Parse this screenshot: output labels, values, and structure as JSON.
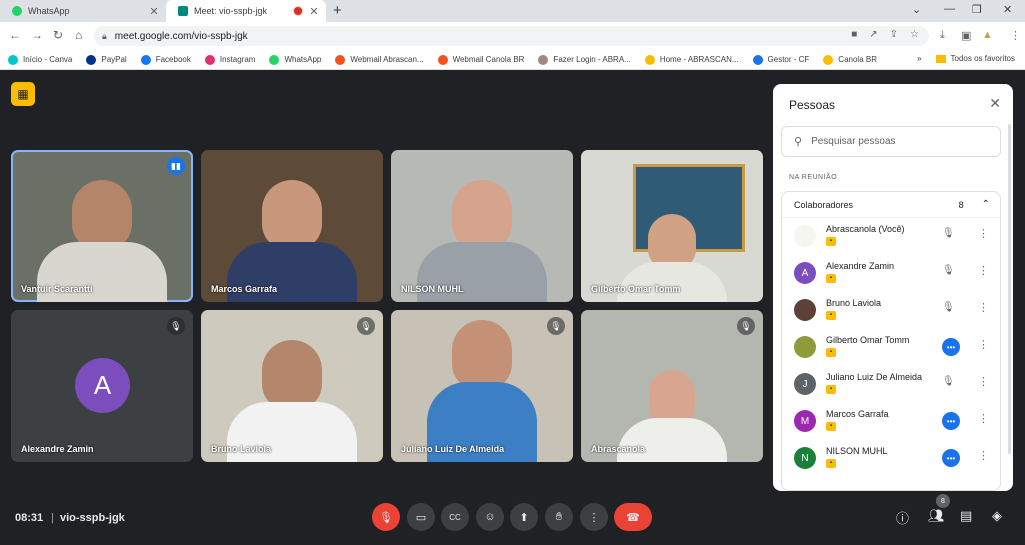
{
  "browser": {
    "tabs": [
      {
        "label": "WhatsApp",
        "active": false,
        "favicon_color": "#25d366"
      },
      {
        "label": "Meet: vio-sspb-jgk",
        "active": true,
        "favicon_color": "#00897b"
      }
    ],
    "new_tab_icon": "plus-icon",
    "url": "meet.google.com/vio-sspb-jgk",
    "bookmarks": [
      {
        "label": "Início - Canva",
        "color": "#00c4cc"
      },
      {
        "label": "PayPal",
        "color": "#003087"
      },
      {
        "label": "Facebook",
        "color": "#1877f2"
      },
      {
        "label": "Instagram",
        "color": "#e1306c"
      },
      {
        "label": "WhatsApp",
        "color": "#25d366"
      },
      {
        "label": "Webmail Abrascan...",
        "color": "#f4511e"
      },
      {
        "label": "Webmail Canola BR",
        "color": "#f4511e"
      },
      {
        "label": "Fazer Login - ABRA...",
        "color": "#a1887f"
      },
      {
        "label": "Home - ABRASCAN...",
        "color": "#fbbc04"
      },
      {
        "label": "Gestor - CF",
        "color": "#1a73e8"
      },
      {
        "label": "Canola BR",
        "color": "#fbbc04"
      }
    ],
    "bookmarks_more": "»",
    "favorites_label": "Todos os favoritos"
  },
  "meet": {
    "tiles": [
      {
        "name": "Vantuir Scarantti",
        "status": "speaking"
      },
      {
        "name": "Marcos Garrafa",
        "status": ""
      },
      {
        "name": "NILSON MUHL",
        "status": ""
      },
      {
        "name": "Gilberto Omar Tomm",
        "status": ""
      },
      {
        "name": "Alexandre Zamin",
        "status": "muted",
        "initial": "A"
      },
      {
        "name": "Bruno Laviola",
        "status": "muted"
      },
      {
        "name": "Juliano Luiz De Almeida",
        "status": "muted"
      },
      {
        "name": "Abrascanola",
        "status": "muted"
      }
    ],
    "time": "08:31",
    "separator": "|",
    "meeting_code": "vio-sspb-jgk",
    "participant_count": "8"
  },
  "panel": {
    "title": "Pessoas",
    "search_placeholder": "Pesquisar pessoas",
    "section_label": "NA REUNIÃO",
    "group_label": "Colaboradores",
    "group_count": "8",
    "people": [
      {
        "name": "Abrascanola (Você)",
        "initial": "",
        "color": "#f6f6f0",
        "state": "muted"
      },
      {
        "name": "Alexandre Zamin",
        "initial": "A",
        "color": "#7c4dbd",
        "state": "muted"
      },
      {
        "name": "Bruno Laviola",
        "initial": "",
        "color": "#5d4037",
        "state": "muted"
      },
      {
        "name": "Gilberto Omar Tomm",
        "initial": "",
        "color": "#8d9b3a",
        "state": "speaking"
      },
      {
        "name": "Juliano Luiz De Almeida",
        "initial": "J",
        "color": "#5f6368",
        "state": "muted"
      },
      {
        "name": "Marcos Garrafa",
        "initial": "M",
        "color": "#9c27b0",
        "state": "speaking"
      },
      {
        "name": "NILSON MUHL",
        "initial": "N",
        "color": "#188038",
        "state": "speaking"
      }
    ]
  }
}
